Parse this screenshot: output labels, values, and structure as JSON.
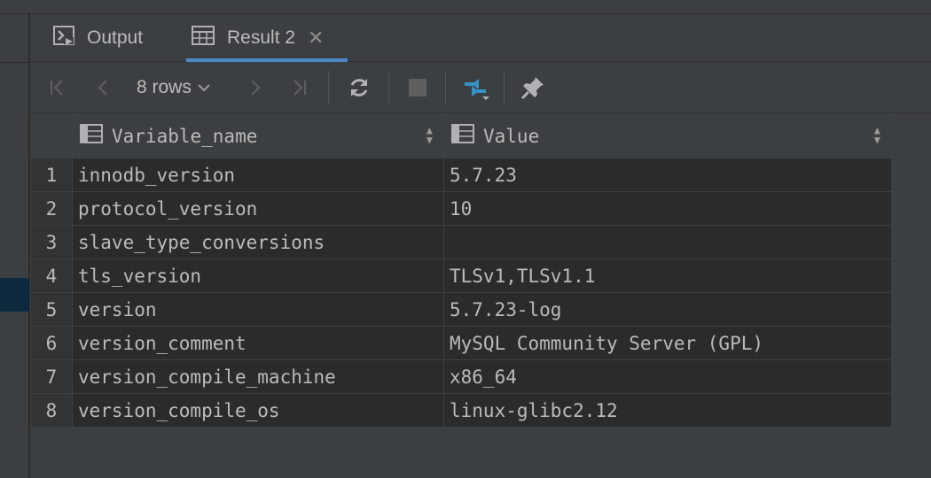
{
  "tabs": [
    {
      "label": "Output",
      "icon": "console-icon"
    },
    {
      "label": "Result 2",
      "icon": "table-icon",
      "close": "✕"
    }
  ],
  "toolbar": {
    "rows_label": "8 rows",
    "icons": [
      "first-page-icon",
      "prev-page-icon",
      "next-page-icon",
      "last-page-icon",
      "refresh-icon",
      "stop-icon",
      "compare-icon",
      "pin-icon"
    ]
  },
  "grid": {
    "columns": [
      "Variable_name",
      "Value"
    ],
    "rows": [
      {
        "n": "1",
        "name": "innodb_version",
        "value": "5.7.23"
      },
      {
        "n": "2",
        "name": "protocol_version",
        "value": "10"
      },
      {
        "n": "3",
        "name": "slave_type_conversions",
        "value": ""
      },
      {
        "n": "4",
        "name": "tls_version",
        "value": "TLSv1,TLSv1.1"
      },
      {
        "n": "5",
        "name": "version",
        "value": "5.7.23-log"
      },
      {
        "n": "6",
        "name": "version_comment",
        "value": "MySQL Community Server (GPL)"
      },
      {
        "n": "7",
        "name": "version_compile_machine",
        "value": "x86_64"
      },
      {
        "n": "8",
        "name": "version_compile_os",
        "value": "linux-glibc2.12"
      }
    ]
  },
  "colors": {
    "accent": "#4a88c7",
    "background": "#2b2b2b",
    "panel": "#3c3f41"
  }
}
